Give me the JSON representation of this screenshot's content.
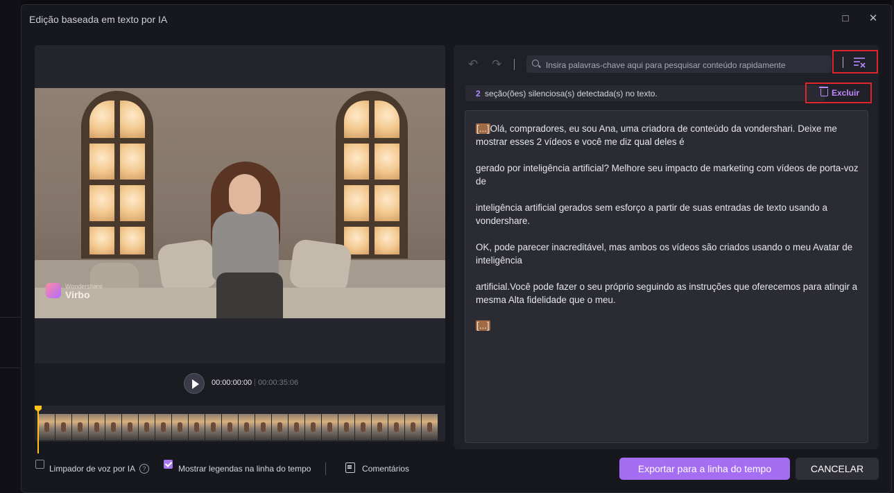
{
  "window": {
    "title": "Edição baseada em texto por IA",
    "maximize_glyph": "□",
    "close_glyph": "✕"
  },
  "player": {
    "current_time": "00:00:00:00",
    "separator": "|",
    "total_time": "00:00:35:06"
  },
  "video": {
    "logo_small": "Wondershare",
    "logo_big": "Virbo"
  },
  "toolbar": {
    "undo_glyph": "↶",
    "redo_glyph": "↷",
    "search_placeholder": "Insira palavras-chave aqui para pesquisar conteúdo rapidamente"
  },
  "notice": {
    "count": "2",
    "message": "seção(ões) silenciosa(s) detectada(s) no texto.",
    "delete_label": "Excluir"
  },
  "transcript": {
    "silence_marker": "[...]",
    "p1": "Olá, compradores, eu sou Ana, uma criadora de conteúdo da vondershari. Deixe me mostrar esses 2 vídeos e você me diz qual deles é",
    "p2": "gerado por inteligência artificial? Melhore seu impacto de marketing com vídeos de porta-voz de",
    "p3": " inteligência artificial gerados sem esforço a partir de suas entradas de texto usando a vondershare.",
    "p4": " OK, pode parecer inacreditável, mas ambos os vídeos são criados usando o meu Avatar de inteligência",
    "p5": " artificial.Você pode fazer o seu próprio seguindo as instruções que oferecemos para atingir a mesma Alta fidelidade que o meu."
  },
  "footer": {
    "voice_cleaner_label": "Limpador de voz por IA",
    "voice_cleaner_checked": false,
    "help_glyph": "?",
    "show_subtitles_label": "Mostrar legendas na linha do tempo",
    "show_subtitles_checked": true,
    "comments_label": "Comentários",
    "export_label": "Exportar para a linha do tempo",
    "cancel_label": "CANCELAR"
  },
  "colors": {
    "accent": "#a56df2",
    "highlight_box": "#e0242b",
    "silence_marker": "#a06a45",
    "playhead": "#ffc21a"
  },
  "icons": [
    "maximize-icon",
    "close-icon",
    "play-icon",
    "undo-icon",
    "redo-icon",
    "search-icon",
    "remove-silence-icon",
    "trash-icon",
    "help-icon",
    "comment-icon"
  ]
}
